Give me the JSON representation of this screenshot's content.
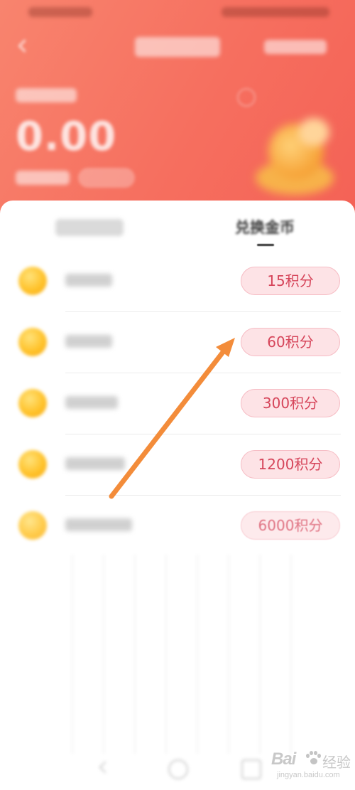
{
  "header": {
    "balance_value": "0.00"
  },
  "tabs": {
    "active_label": "兑换金币"
  },
  "exchange_items": [
    {
      "cost": "15积分"
    },
    {
      "cost": "60积分"
    },
    {
      "cost": "300积分"
    },
    {
      "cost": "1200积分"
    },
    {
      "cost": "6000积分"
    }
  ],
  "colors": {
    "header_gradient_start": "#f8846e",
    "header_gradient_end": "#f46256",
    "button_bg": "#fde3e6",
    "button_text": "#d6455a",
    "arrow": "#f38c3a"
  },
  "watermark": {
    "logo": "Bai",
    "text": "经验",
    "url": "jingyan.baidu.com"
  }
}
